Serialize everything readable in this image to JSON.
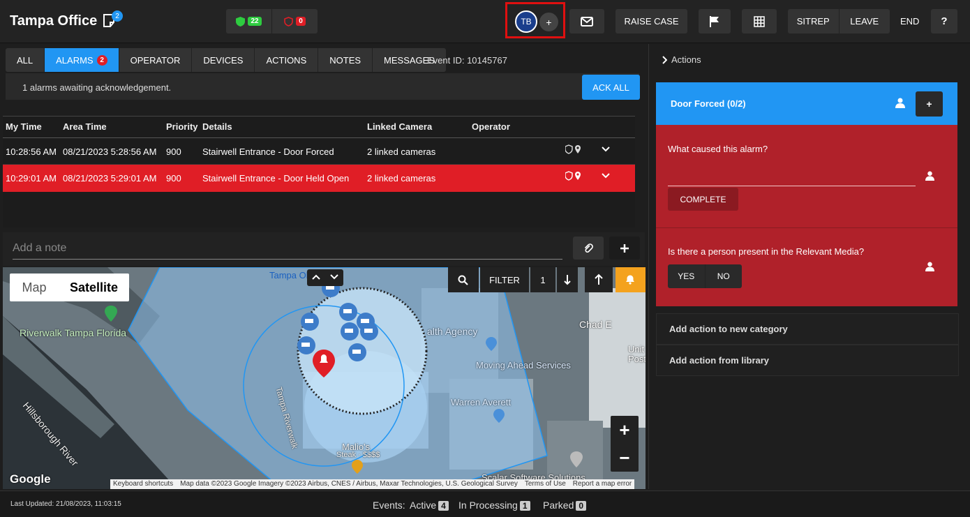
{
  "header": {
    "office_title": "Tampa Office",
    "notes_count": "2",
    "status_green": "22",
    "status_red": "0",
    "operator_initials": "TB",
    "add_operator": "+",
    "raise_case": "RAISE CASE",
    "sitrep": "SITREP",
    "leave": "LEAVE",
    "end": "END",
    "help": "?",
    "colors": {
      "accent": "#2196f3",
      "alarm": "#e01e26",
      "highlight": "#e01010"
    }
  },
  "tabs": [
    {
      "label": "ALL"
    },
    {
      "label": "ALARMS",
      "badge": "2"
    },
    {
      "label": "OPERATOR"
    },
    {
      "label": "DEVICES"
    },
    {
      "label": "ACTIONS"
    },
    {
      "label": "NOTES"
    },
    {
      "label": "MESSAGES"
    }
  ],
  "event_id": "Event ID: 10145767",
  "ack": {
    "message": "1 alarms awaiting acknowledgement.",
    "button": "ACK ALL"
  },
  "table": {
    "headers": [
      "My Time",
      "Area Time",
      "Priority",
      "Details",
      "Linked Camera",
      "Operator"
    ],
    "rows": [
      {
        "my_time": "10:28:56 AM",
        "area_time": "08/21/2023 5:28:56 AM",
        "priority": "900",
        "details": "Stairwell Entrance - Door Forced",
        "linked": "2 linked cameras",
        "operator": ""
      },
      {
        "my_time": "10:29:01 AM",
        "area_time": "08/21/2023 5:29:01 AM",
        "priority": "900",
        "details": "Stairwell Entrance - Door Held Open",
        "linked": "2 linked cameras",
        "operator": ""
      }
    ]
  },
  "note": {
    "placeholder": "Add a note"
  },
  "map": {
    "map_label": "Map",
    "satellite_label": "Satellite",
    "filter": "FILTER",
    "filter_count": "1",
    "zoom_in": "+",
    "zoom_out": "−",
    "labels": {
      "riverwalk": "Riverwalk Tampa Florida",
      "river": "Hillsborough River",
      "health": "alth Agency",
      "moving": "Moving Ahead Services",
      "warren": "Warren Averett",
      "chad": "Chad E",
      "tampa_top": "Tampa Ol",
      "tampa_riverwalk": "Tampa Riverwalk",
      "malios": "Malio's",
      "steak": "Steak · $$$$",
      "scalar": "Scalar Software Solutions",
      "unit": "Unit",
      "post": "Post",
      "google": "Google"
    },
    "attribution": {
      "shortcuts": "Keyboard shortcuts",
      "data": "Map data ©2023 Google Imagery ©2023 Airbus, CNES / Airbus, Maxar Technologies, U.S. Geological Survey",
      "terms": "Terms of Use",
      "report": "Report a map error"
    }
  },
  "actions_panel": {
    "title": "Actions",
    "card_title": "Door Forced (0/2)",
    "card_add": "+",
    "question1": "What caused this alarm?",
    "complete": "COMPLETE",
    "question2": "Is there a person present in the Relevant Media?",
    "yes": "YES",
    "no": "NO",
    "add_category": "Add action to new category",
    "add_library": "Add action from library"
  },
  "footer": {
    "last_updated": "Last Updated: 21/08/2023, 11:03:15",
    "events_label": "Events:",
    "active_label": "Active",
    "active_count": "4",
    "processing_label": "In Processing",
    "processing_count": "1",
    "parked_label": "Parked",
    "parked_count": "0"
  }
}
